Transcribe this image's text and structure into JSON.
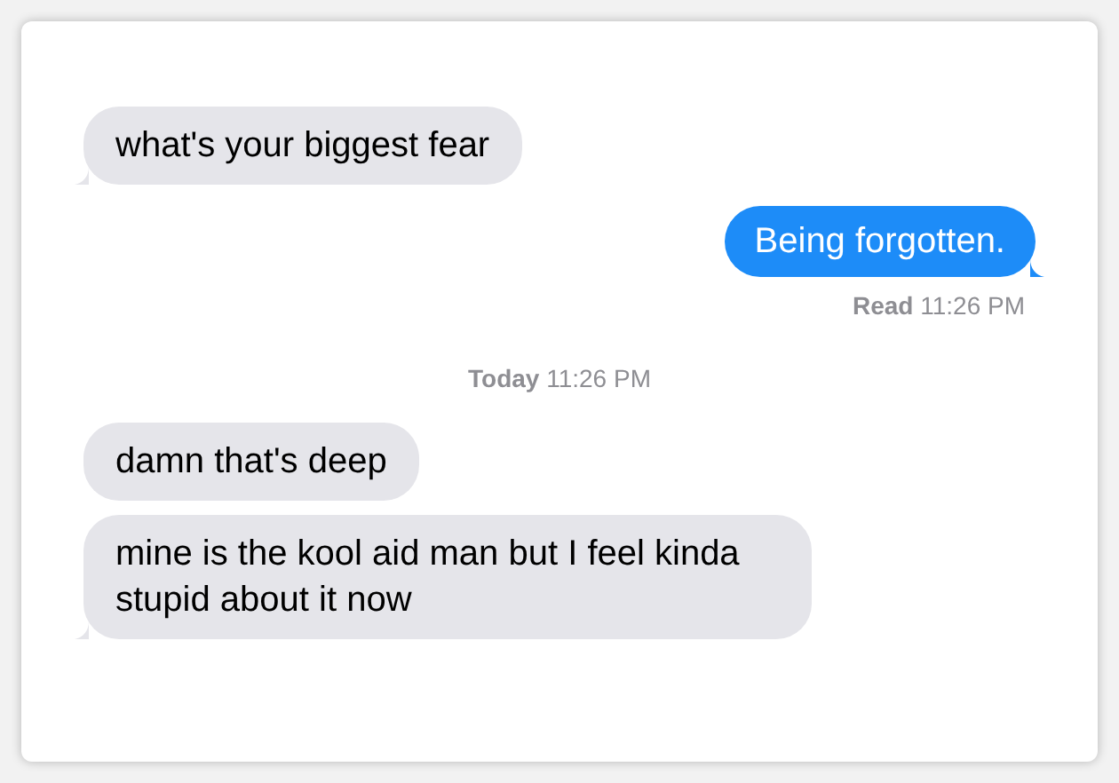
{
  "messages": [
    {
      "kind": "incoming",
      "text": "what's your biggest fear",
      "tail": true
    },
    {
      "kind": "outgoing",
      "text": "Being forgotten.",
      "tail": true
    },
    {
      "kind": "receipt",
      "text": "**Read** 11:26 PM"
    },
    {
      "kind": "timestamp",
      "text": "**Today** 11:26 PM"
    },
    {
      "kind": "incoming",
      "text": "damn that's deep",
      "tail": false
    },
    {
      "kind": "incoming",
      "text": "mine is the kool aid man but I feel kinda stupid about it now",
      "tail": true
    }
  ]
}
